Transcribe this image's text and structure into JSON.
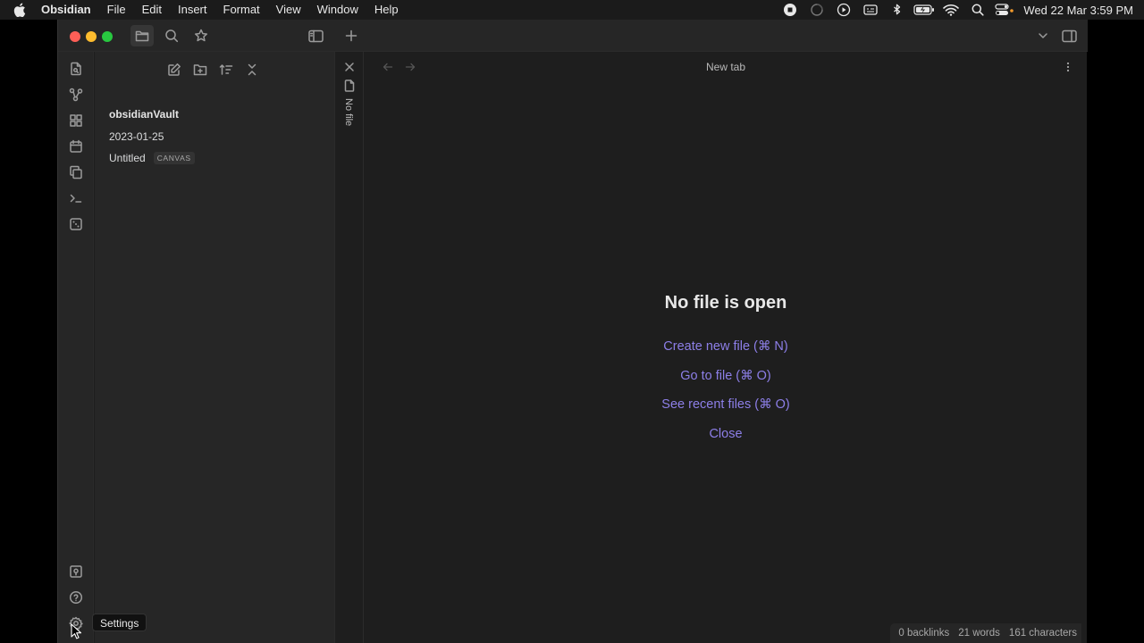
{
  "menubar": {
    "app_name": "Obsidian",
    "menus": [
      "File",
      "Edit",
      "Insert",
      "Format",
      "View",
      "Window",
      "Help"
    ],
    "clock": "Wed 22 Mar  3:59 PM"
  },
  "sidebar": {
    "vault_name": "obsidianVault",
    "files": [
      {
        "name": "2023-01-25",
        "tag": ""
      },
      {
        "name": "Untitled",
        "tag": "CANVAS"
      }
    ]
  },
  "main": {
    "stacked_tab_label": "No file",
    "tab_title": "New tab",
    "empty_title": "No file is open",
    "actions": [
      "Create new file (⌘ N)",
      "Go to file (⌘ O)",
      "See recent files (⌘ O)",
      "Close"
    ]
  },
  "statusbar": {
    "backlinks": "0 backlinks",
    "words": "21 words",
    "characters": "161 characters"
  },
  "tooltip": {
    "settings": "Settings"
  },
  "colors": {
    "accent": "#8d7fe8",
    "background": "#1e1e1e",
    "sidebar": "#262626"
  }
}
